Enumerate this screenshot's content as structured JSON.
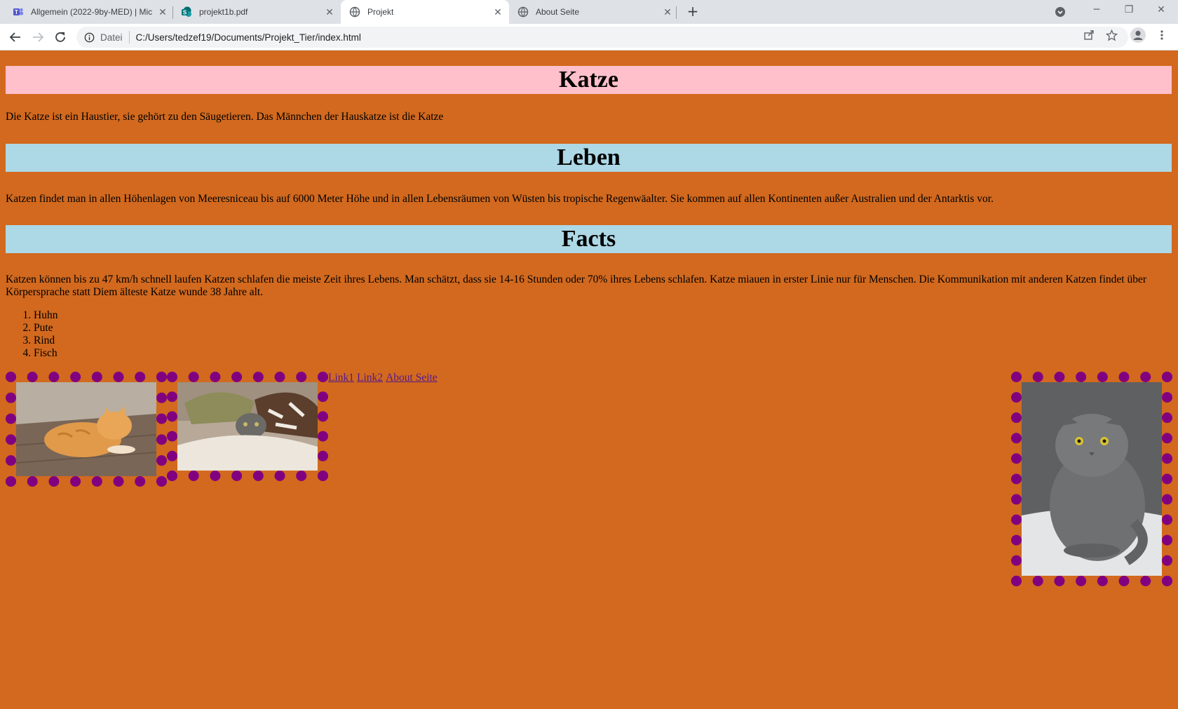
{
  "browser": {
    "tabs": [
      {
        "title": "Allgemein (2022-9by-MED) | Mic",
        "icon": "teams-icon"
      },
      {
        "title": "projekt1b.pdf",
        "icon": "sharepoint-icon"
      },
      {
        "title": "Projekt",
        "icon": "globe-icon",
        "active": true
      },
      {
        "title": "About Seite",
        "icon": "globe-icon"
      }
    ],
    "address": {
      "label": "Datei",
      "url": "C:/Users/tedzef19/Documents/Projekt_Tier/index.html"
    }
  },
  "page": {
    "sections": [
      {
        "heading": "Katze",
        "heading_bg": "#ffc0cb",
        "text": "Die Katze ist ein Haustier, sie gehört zu den Säugetieren. Das Männchen der Hauskatze ist die Katze"
      },
      {
        "heading": "Leben",
        "heading_bg": "#add8e6",
        "text": "Katzen findet man in allen Höhenlagen von Meeresniceau bis auf 6000 Meter Höhe und in allen Lebensräumen von Wüsten bis tropische Regenwäalter. Sie kommen auf allen Kontinenten außer Australien und der Antarktis vor."
      },
      {
        "heading": "Facts",
        "heading_bg": "#add8e6",
        "text": "Katzen können bis zu 47 km/h schnell laufen Katzen schlafen die meiste Zeit ihres Lebens. Man schätzt, dass sie 14-16 Stunden oder 70% ihres Lebens schlafen. Katze miauen in erster Linie nur für Menschen. Die Kommunikation mit anderen Katzen findet über Körpersprache statt Diem älteste Katze wunde 38 Jahre alt."
      }
    ],
    "list": [
      "Huhn",
      "Pute",
      "Rind",
      "Fisch"
    ],
    "links": [
      "Link1",
      "Link2",
      "About Seite"
    ],
    "images": [
      "orange-cat-image",
      "cat-under-blanket-image",
      "grey-cat-image"
    ],
    "colors": {
      "background": "#d2691e",
      "border": "#800080",
      "link": "#551a8b"
    }
  }
}
